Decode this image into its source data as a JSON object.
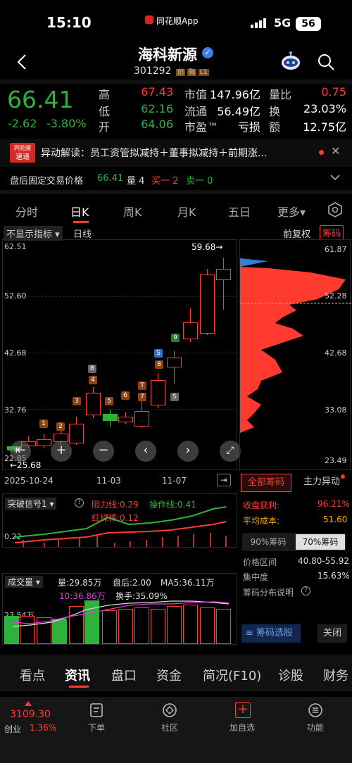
{
  "status_bar": {
    "time": "15:10",
    "center_app": "同花顺App",
    "signal": "5G",
    "battery": "56"
  },
  "header": {
    "title": "海科新源",
    "code": "301292",
    "tags": [
      "创",
      "融",
      "L1"
    ]
  },
  "quote": {
    "price": "66.41",
    "change": "-2.62",
    "change_pct": "-3.80%",
    "stats": [
      {
        "label": "高",
        "value": "67.43",
        "color": "#ff3b30"
      },
      {
        "label": "市值",
        "value": "147.96亿",
        "color": "#ffffff"
      },
      {
        "label": "量比",
        "value": "0.75",
        "color": "#ff3b30"
      },
      {
        "label": "低",
        "value": "62.16",
        "color": "#2db33c"
      },
      {
        "label": "流通",
        "value": "56.49亿",
        "color": "#ffffff"
      },
      {
        "label": "换",
        "value": "23.03%",
        "color": "#ffffff"
      },
      {
        "label": "开",
        "value": "64.06",
        "color": "#2db33c"
      },
      {
        "label": "市盈™",
        "value": "亏损",
        "color": "#ffffff"
      },
      {
        "label": "额",
        "value": "12.75亿",
        "color": "#ffffff"
      }
    ]
  },
  "news": {
    "logo_top": "同花顺",
    "logo_bottom": "速递",
    "text": "异动解读：员工资管拟减持＋董事拟减持＋前期涨..."
  },
  "after_hours": {
    "label": "盘后固定交易价格",
    "price": "66.41",
    "volume": "量 4",
    "buy": "买一 2",
    "sell": "卖一 0"
  },
  "period_tabs": [
    "分时",
    "日K",
    "周K",
    "月K",
    "五日",
    "更多▾"
  ],
  "active_tab": "日K",
  "indicator_bar": {
    "indicator": "不显示指标",
    "period": "日线",
    "adjust": "前复权",
    "chip": "筹码"
  },
  "kline": {
    "y_labels": [
      "62.51",
      "52.60",
      "42.68",
      "32.76",
      "22.85"
    ],
    "high_label": "59.68→",
    "low_label": "←25.68",
    "x_labels": [
      "2025-10-24",
      "11-03",
      "11-07"
    ],
    "badge_labels": [
      "1",
      "2",
      "3",
      "4",
      "B",
      "5",
      "6",
      "7",
      "T",
      "8",
      "S",
      "9",
      "S"
    ]
  },
  "chips": {
    "y_labels": [
      "61.87",
      "52.28",
      "42.68",
      "33.08",
      "23.49"
    ],
    "buttons": [
      "全部筹码",
      "主力异动"
    ],
    "rows": [
      {
        "label": "收盘获利:",
        "value": "96.21%",
        "color": "#ff3b30"
      },
      {
        "label": "平均成本:",
        "value": "51.60",
        "color": "#ffb000"
      }
    ],
    "pct_buttons": [
      "90%筹码",
      "70%筹码"
    ],
    "rows2": [
      {
        "label": "价格区间",
        "value": "40.80-55.92"
      },
      {
        "label": "集中度",
        "value": "15.63%"
      },
      {
        "label": "筹码分布说明",
        "value": ""
      }
    ],
    "select_btn": "筹码选股",
    "close_btn": "关闭"
  },
  "signal": {
    "name": "突破信号1",
    "resistance": "阻力线:0.29",
    "operation": "操作线:0.41",
    "redgreen": "红绿棒:0.12",
    "y_label": "0.22"
  },
  "volume": {
    "name": "成交量",
    "vol": "量:29.85万",
    "after": "盘后:2.00",
    "ma5": "MA5:36.11万",
    "ma10": "10:36.86万",
    "turnover": "换手:35.09%",
    "y_label": "23.54万"
  },
  "bottom_tabs": [
    "看点",
    "资讯",
    "盘口",
    "资金",
    "简况(F10)",
    "诊股",
    "财务"
  ],
  "active_bottom": "资讯",
  "index_info": {
    "value": "3109.30",
    "name": "创业",
    "pct": "1.36%"
  },
  "nav": [
    "下单",
    "社区",
    "加自选",
    "功能"
  ],
  "colors": {
    "up": "#ff3b30",
    "down": "#2db33c",
    "bg": "#000000",
    "accent": "#ff3b30"
  }
}
